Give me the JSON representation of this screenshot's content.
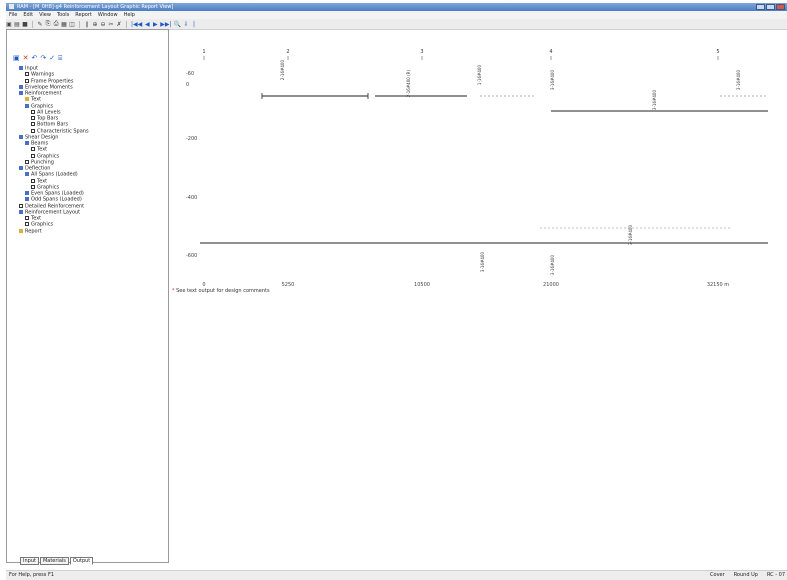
{
  "window": {
    "title": "RAM - [M_0H8]-g4 Reinforcement Layout Graphic Report View]"
  },
  "menu": [
    "File",
    "Edit",
    "View",
    "Tools",
    "Report",
    "Window",
    "Help"
  ],
  "toolbar": {
    "icons": [
      "new-icon",
      "open-icon",
      "save-icon",
      "print-icon",
      "copy-icon",
      "paste-icon",
      "zoom-in-icon",
      "zoom-out-icon",
      "first-page-icon",
      "prev-page-icon",
      "next-page-icon",
      "last-page-icon",
      "zoom-icon",
      "refresh-icon"
    ],
    "glyphs": [
      "▣",
      "▤",
      "■",
      "✎",
      "⎘",
      "⎙",
      "▦",
      "◫",
      "∥",
      "⊕",
      "⊖",
      "✂",
      "✗",
      "|◀◀",
      "◀",
      "▶",
      "▶▶|",
      "🔍",
      "⇩",
      "|"
    ]
  },
  "tree_toolbar": {
    "glyphs": [
      "▣",
      "✕",
      "↶",
      "↷",
      "✓",
      "⌸"
    ]
  },
  "tree": [
    {
      "indent": 0,
      "icon": "folder",
      "label": "Input"
    },
    {
      "indent": 1,
      "icon": "check",
      "label": "Warnings"
    },
    {
      "indent": 1,
      "icon": "box",
      "label": "Frame Properties"
    },
    {
      "indent": 0,
      "icon": "folder",
      "label": "Envelope Moments"
    },
    {
      "indent": 0,
      "icon": "folder",
      "label": "Reinforcement"
    },
    {
      "indent": 1,
      "icon": "fold-y",
      "label": "Text"
    },
    {
      "indent": 1,
      "icon": "folder",
      "label": "Graphics"
    },
    {
      "indent": 2,
      "icon": "check",
      "label": "All Levels"
    },
    {
      "indent": 2,
      "icon": "check",
      "label": "Top Bars"
    },
    {
      "indent": 2,
      "icon": "check",
      "label": "Bottom Bars"
    },
    {
      "indent": 2,
      "icon": "check",
      "label": "Characteristic Spans"
    },
    {
      "indent": 0,
      "icon": "folder",
      "label": "Shear Design"
    },
    {
      "indent": 1,
      "icon": "folder",
      "label": "Beams"
    },
    {
      "indent": 2,
      "icon": "box",
      "label": "Text"
    },
    {
      "indent": 2,
      "icon": "box",
      "label": "Graphics"
    },
    {
      "indent": 1,
      "icon": "check",
      "label": "Punching"
    },
    {
      "indent": 0,
      "icon": "folder",
      "label": "Deflection"
    },
    {
      "indent": 1,
      "icon": "folder",
      "label": "All Spans (Loaded)"
    },
    {
      "indent": 2,
      "icon": "box",
      "label": "Text"
    },
    {
      "indent": 2,
      "icon": "check",
      "label": "Graphics"
    },
    {
      "indent": 1,
      "icon": "folder",
      "label": "Even Spans (Loaded)"
    },
    {
      "indent": 1,
      "icon": "folder",
      "label": "Odd Spans (Loaded)"
    },
    {
      "indent": 0,
      "icon": "check",
      "label": "Detailed Reinforcement"
    },
    {
      "indent": 0,
      "icon": "folder",
      "label": "Reinforcement Layout"
    },
    {
      "indent": 1,
      "icon": "box",
      "label": "Text"
    },
    {
      "indent": 1,
      "icon": "check",
      "label": "Graphics"
    },
    {
      "indent": 0,
      "icon": "fold-y",
      "label": "Report"
    }
  ],
  "tabs": [
    "Input",
    "Materials",
    "Output"
  ],
  "active_tab": "Output",
  "status": {
    "help": "For Help, press F1",
    "items": [
      "Cover",
      "Round Up",
      "RC - 07"
    ]
  },
  "note": {
    "star": "*",
    "text": "See text output for design comments"
  },
  "chart_data": {
    "type": "diagram",
    "span_labels": [
      "1",
      "2",
      "3",
      "4",
      "5"
    ],
    "y_ticks": [
      "-60",
      "0",
      "-200",
      "-400",
      "-600"
    ],
    "x_ticks": [
      "0",
      "5250",
      "10500",
      "21000",
      "32150 m"
    ],
    "bar_labels": [
      "2-16#400",
      "2-16#400 (R)",
      "1-16#400",
      "3-16#400",
      "3-16#400",
      "3-16#400",
      "3-16#400",
      "3-16#400",
      "3-16#400"
    ]
  },
  "colors": {
    "title_bg": "#4b7fc3",
    "accent": "#1e58c6",
    "bar": "#222222"
  }
}
